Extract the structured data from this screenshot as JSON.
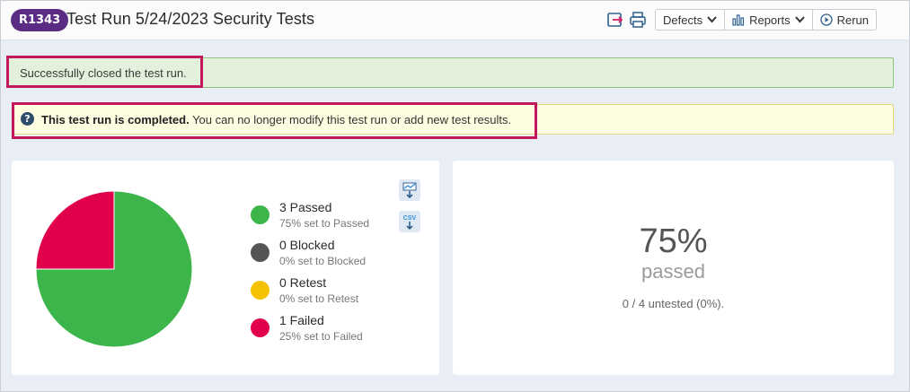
{
  "header": {
    "run_id": "R1343",
    "title": "Test Run 5/24/2023 Security Tests",
    "icons": [
      "export-icon",
      "print-icon"
    ],
    "toolbar": {
      "defects_label": "Defects",
      "reports_label": "Reports",
      "rerun_label": "Rerun"
    }
  },
  "messages": {
    "success": "Successfully closed the test run.",
    "info_bold": "This test run is completed.",
    "info_rest": " You can no longer modify this test run or add new test results."
  },
  "colors": {
    "passed": "#3cb54a",
    "blocked": "#555555",
    "retest": "#f4c200",
    "failed": "#e0004d",
    "badge": "#5b2c83",
    "highlight": "#c2185b"
  },
  "legend": [
    {
      "title": "3 Passed",
      "sub": "75% set to Passed",
      "color": "#3cb54a"
    },
    {
      "title": "0 Blocked",
      "sub": "0% set to Blocked",
      "color": "#555555"
    },
    {
      "title": "0 Retest",
      "sub": "0% set to Retest",
      "color": "#f4c200"
    },
    {
      "title": "1 Failed",
      "sub": "25% set to Failed",
      "color": "#e0004d"
    }
  ],
  "downloads": {
    "image_icon": "chart-download-icon",
    "csv_label": "CSV"
  },
  "chart_data": {
    "type": "pie",
    "categories": [
      "Passed",
      "Blocked",
      "Retest",
      "Failed"
    ],
    "values": [
      3,
      0,
      0,
      1
    ],
    "colors": [
      "#3cb54a",
      "#555555",
      "#f4c200",
      "#e0004d"
    ]
  },
  "summary": {
    "percent": "75%",
    "label": "passed",
    "untested": "0 / 4 untested (0%)."
  }
}
